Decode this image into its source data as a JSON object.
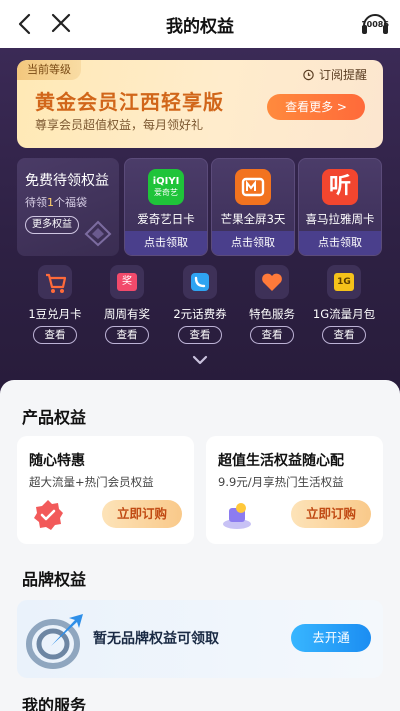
{
  "nav": {
    "title": "我的权益",
    "service_number": "10086"
  },
  "membership": {
    "badge": "当前等级",
    "subscribe_label": "订阅提醒",
    "name": "黄金会员江西轻享版",
    "desc": "尊享会员超值权益，每月领好礼",
    "more_label": "查看更多 >"
  },
  "free_benefits": {
    "title": "免费待领权益",
    "sub_prefix": "待领",
    "count": "1",
    "sub_suffix": "个福袋",
    "more_label": "更多权益"
  },
  "vip_cards": [
    {
      "logo_text": "iQIYI",
      "logo_sub": "爱奇艺",
      "name": "爱奇艺日卡",
      "btn": "点击领取",
      "color": "#1fc43a"
    },
    {
      "name": "芒果全屏3天",
      "btn": "点击领取",
      "color": "#f2731f"
    },
    {
      "logo_text": "听",
      "name": "喜马拉雅周卡",
      "btn": "点击领取",
      "color": "#f2462f"
    }
  ],
  "small_items": [
    {
      "name": "1豆兑月卡",
      "btn": "查看",
      "icon": "cart-icon"
    },
    {
      "name": "周周有奖",
      "btn": "查看",
      "icon": "ticket-icon",
      "icon_text": "奖"
    },
    {
      "name": "2元话费券",
      "btn": "查看",
      "icon": "phone-coupon-icon"
    },
    {
      "name": "特色服务",
      "btn": "查看",
      "icon": "heart-icon"
    },
    {
      "name": "1G流量月包",
      "btn": "查看",
      "icon": "data-pack-icon",
      "icon_text": "1G"
    }
  ],
  "product_section": {
    "title": "产品权益",
    "cards": [
      {
        "title": "随心特惠",
        "desc": "超大流量+热门会员权益",
        "btn": "立即订购"
      },
      {
        "title": "超值生活权益随心配",
        "desc": "9.9元/月享热门生活权益",
        "btn": "立即订购"
      }
    ]
  },
  "brand_section": {
    "title": "品牌权益",
    "text": "暂无品牌权益可领取",
    "btn": "去开通"
  },
  "service_section": {
    "title": "我的服务"
  }
}
